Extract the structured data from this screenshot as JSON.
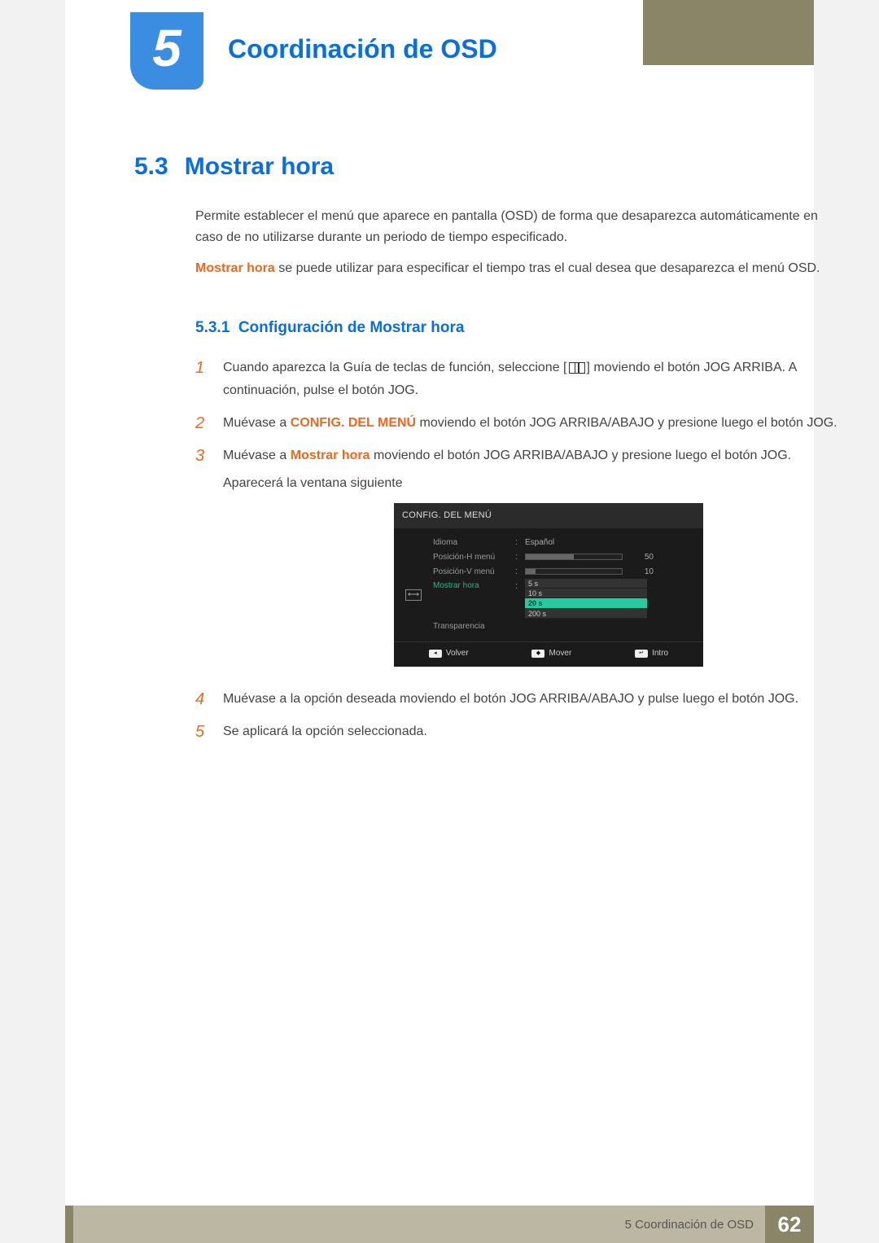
{
  "chapter": {
    "number": "5",
    "title": "Coordinación de OSD"
  },
  "section": {
    "number": "5.3",
    "title": "Mostrar hora"
  },
  "intro": {
    "p1": "Permite establecer el menú que aparece en pantalla (OSD) de forma que desaparezca automáticamente en caso de no utilizarse durante un periodo de tiempo especificado.",
    "p2_bold": "Mostrar hora",
    "p2_rest": " se puede utilizar para especificar el tiempo tras el cual desea que desaparezca el menú OSD."
  },
  "subsection": {
    "number": "5.3.1",
    "title": "Configuración de Mostrar hora"
  },
  "steps": {
    "s1": {
      "num": "1",
      "pre": "Cuando aparezca la Guía de teclas de función, seleccione [",
      "post": "] moviendo el botón JOG ARRIBA. A continuación, pulse el botón JOG."
    },
    "s2": {
      "num": "2",
      "pre": "Muévase a ",
      "bold": "CONFIG. DEL MENÚ",
      "post": " moviendo el botón JOG ARRIBA/ABAJO y presione luego el botón JOG."
    },
    "s3": {
      "num": "3",
      "pre": "Muévase a ",
      "bold": "Mostrar hora",
      "post": " moviendo el botón JOG ARRIBA/ABAJO y presione luego el botón JOG.",
      "line2": "Aparecerá la ventana siguiente"
    },
    "s4": {
      "num": "4",
      "text": "Muévase a la opción deseada moviendo el botón JOG ARRIBA/ABAJO y pulse luego el botón JOG."
    },
    "s5": {
      "num": "5",
      "text": "Se aplicará la opción seleccionada."
    }
  },
  "osd": {
    "title": "CONFIG. DEL MENÚ",
    "rows": {
      "idioma": {
        "label": "Idioma",
        "value": "Español"
      },
      "posH": {
        "label": "Posición-H menú",
        "value": "50",
        "fill": 50
      },
      "posV": {
        "label": "Posición-V menú",
        "value": "10",
        "fill": 10
      },
      "mostrar": {
        "label": "Mostrar hora"
      },
      "trans": {
        "label": "Transparencia"
      }
    },
    "options": [
      "5 s",
      "10 s",
      "20 s",
      "200 s"
    ],
    "footer": {
      "volver": "Volver",
      "mover": "Mover",
      "intro": "Intro"
    }
  },
  "footer": {
    "label": "5 Coordinación de OSD",
    "page": "62"
  }
}
